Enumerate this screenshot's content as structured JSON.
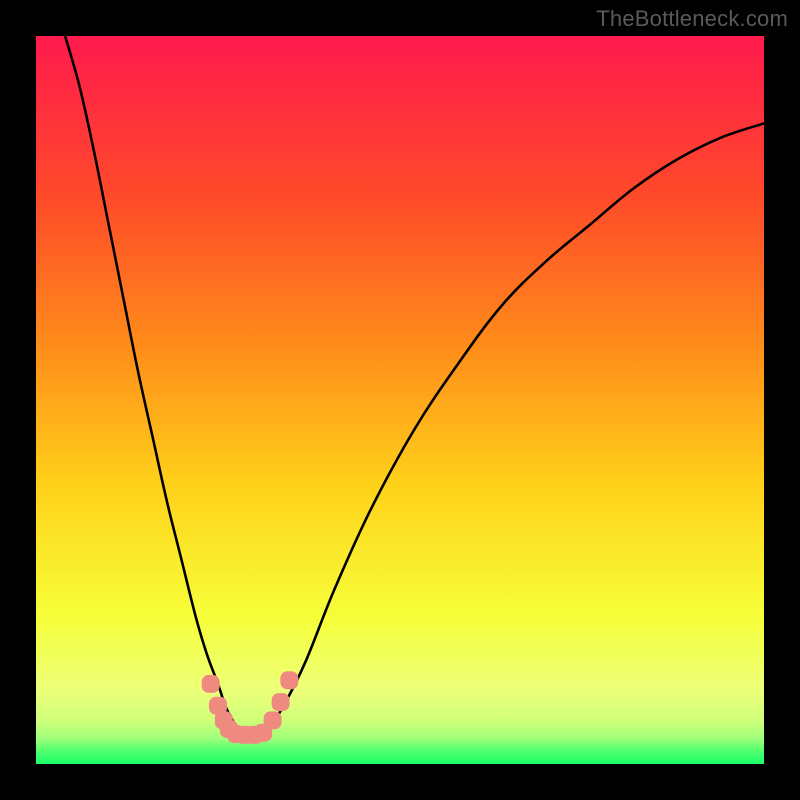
{
  "watermark": "TheBottleneck.com",
  "chart_data": {
    "type": "line",
    "title": "",
    "xlabel": "",
    "ylabel": "",
    "xlim": [
      0,
      100
    ],
    "ylim": [
      0,
      100
    ],
    "gradient_colors": {
      "top": "#ff1a4d",
      "upper_mid": "#ff7a1a",
      "mid": "#ffd21a",
      "lower_mid": "#f6ff3a",
      "lower": "#e8ff76",
      "bottom_thin_1": "#b6ff7a",
      "bottom_thin_2": "#6fff7a",
      "bottom": "#1aff66"
    },
    "series": [
      {
        "name": "bottleneck-curve",
        "x": [
          4,
          6,
          8,
          10,
          12,
          14,
          16,
          18,
          20,
          22,
          23.5,
          25,
          26,
          27,
          28,
          28.7,
          29.5,
          30.5,
          32,
          34,
          37,
          41,
          46,
          52,
          58,
          64,
          70,
          76,
          82,
          88,
          94,
          100
        ],
        "y": [
          100,
          93,
          84,
          74,
          64,
          54,
          45,
          36,
          28,
          20,
          15,
          11,
          8,
          6,
          4.5,
          4,
          4,
          4.2,
          5,
          8,
          14,
          24,
          35,
          46,
          55,
          63,
          69,
          74,
          79,
          83,
          86,
          88
        ]
      }
    ],
    "markers": {
      "name": "trough-markers",
      "color": "#ef8a80",
      "points": [
        {
          "x": 24.0,
          "y": 11.0
        },
        {
          "x": 25.0,
          "y": 8.0
        },
        {
          "x": 25.8,
          "y": 6.0
        },
        {
          "x": 26.5,
          "y": 4.8
        },
        {
          "x": 27.5,
          "y": 4.1
        },
        {
          "x": 28.7,
          "y": 4.0
        },
        {
          "x": 30.0,
          "y": 4.0
        },
        {
          "x": 31.2,
          "y": 4.3
        },
        {
          "x": 32.5,
          "y": 6.0
        },
        {
          "x": 33.6,
          "y": 8.5
        },
        {
          "x": 34.8,
          "y": 11.5
        }
      ]
    }
  }
}
